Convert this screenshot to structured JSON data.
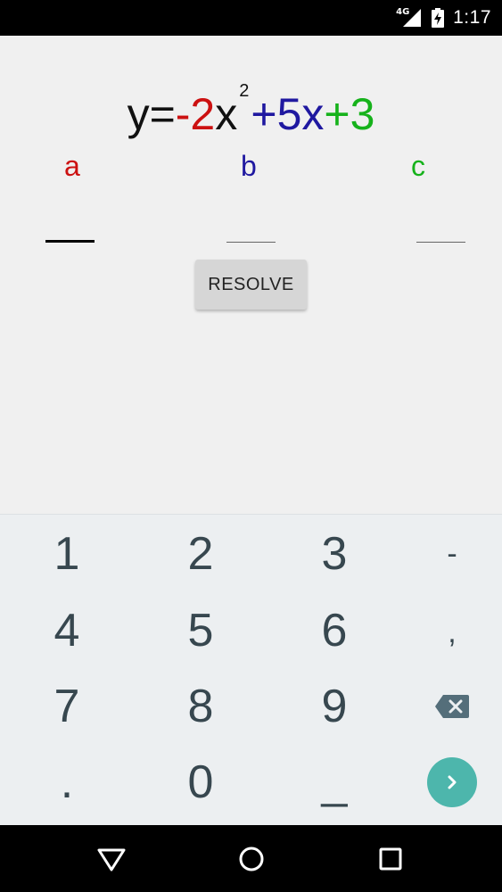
{
  "status_bar": {
    "network_label": "4G",
    "time": "1:17"
  },
  "equation": {
    "prefix": "y=",
    "a_term": "-2",
    "x1": "x",
    "exponent": "2",
    "b_term": "+5",
    "x2": "x",
    "c_term": "+3"
  },
  "coefficients": {
    "a_label": "a",
    "b_label": "b",
    "c_label": "c"
  },
  "inputs": {
    "a_value": "",
    "b_value": "",
    "c_value": ""
  },
  "resolve_button": {
    "label": "RESOLVE"
  },
  "keyboard": {
    "keys": {
      "k1": "1",
      "k2": "2",
      "k3": "3",
      "kminus": "-",
      "k4": "4",
      "k5": "5",
      "k6": "6",
      "kcomma": ",",
      "k7": "7",
      "k8": "8",
      "k9": "9",
      "kdot": ".",
      "k0": "0",
      "kspace": "_"
    },
    "icons": {
      "backspace": "backspace-icon",
      "enter": "chevron-right-icon"
    },
    "enter_color": "#4db6ac"
  },
  "colors": {
    "a": "#cc1111",
    "b": "#1f18a0",
    "c": "#16b21b"
  },
  "nav_bar": {
    "icons": [
      "back-icon",
      "home-icon",
      "recents-icon"
    ]
  }
}
